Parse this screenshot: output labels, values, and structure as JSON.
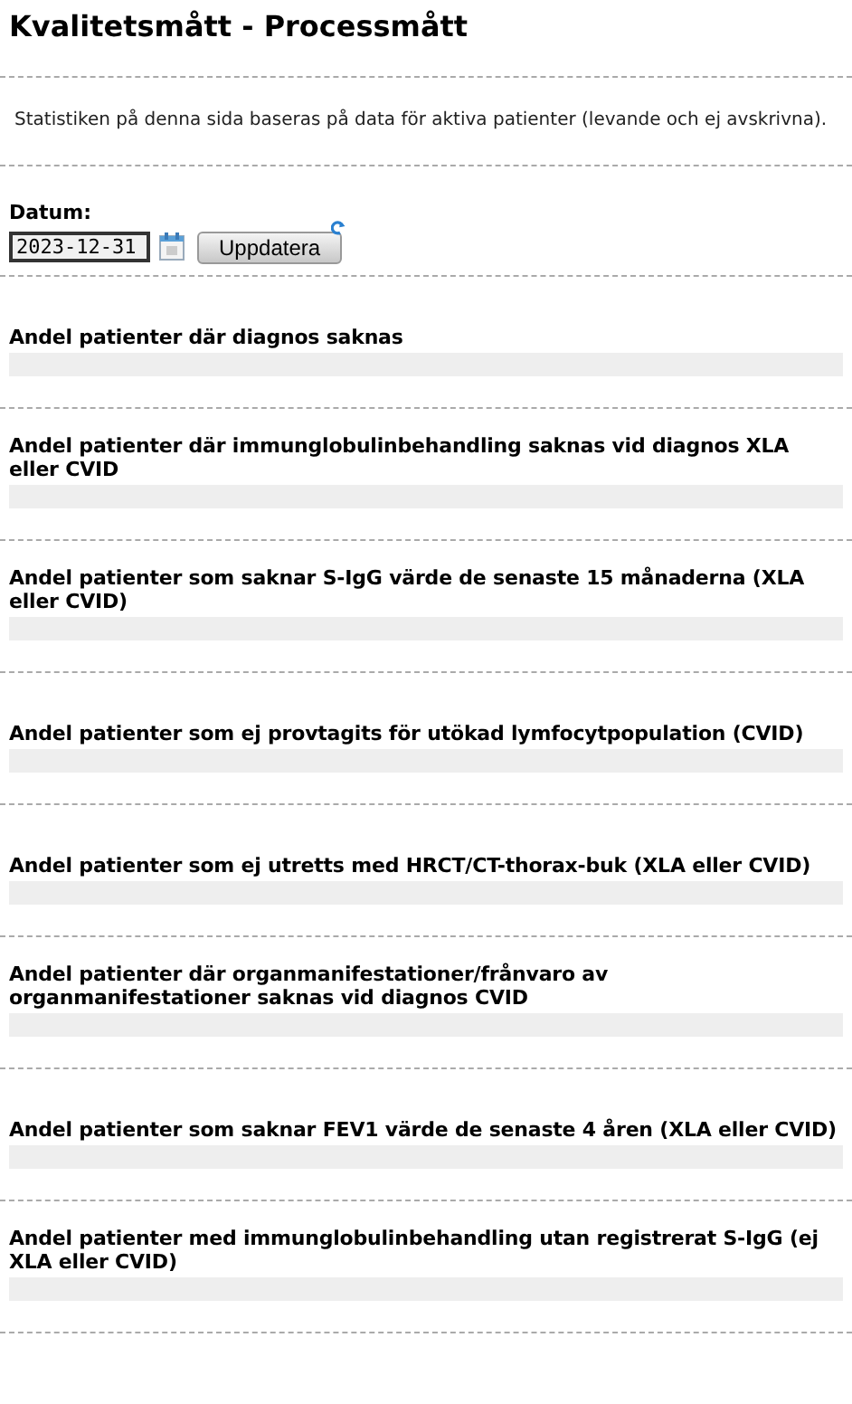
{
  "title": "Kvalitetsmått - Processmått",
  "note": "Statistiken på denna sida baseras på data för aktiva patienter (levande och ej avskrivna).",
  "date_form": {
    "label": "Datum:",
    "value": "2023-12-31",
    "button": "Uppdatera"
  },
  "sections": [
    {
      "heading": "Andel patienter där diagnos saknas"
    },
    {
      "heading": "Andel patienter där immunglobulinbehandling saknas vid diagnos XLA eller CVID"
    },
    {
      "heading": "Andel patienter som saknar S-IgG värde de senaste 15 månaderna (XLA eller CVID)"
    },
    {
      "heading": "Andel patienter som ej provtagits för utökad lymfocytpopulation (CVID)"
    },
    {
      "heading": "Andel patienter som ej utretts med HRCT/CT-thorax-buk (XLA eller CVID)"
    },
    {
      "heading": "Andel patienter där organmanifestationer/frånvaro av organmanifestationer saknas vid diagnos CVID"
    },
    {
      "heading": "Andel patienter som saknar FEV1 värde de senaste 4 åren (XLA eller CVID)"
    },
    {
      "heading": "Andel patienter med immunglobulinbehandling utan registrerat S-IgG (ej XLA eller CVID)"
    }
  ]
}
